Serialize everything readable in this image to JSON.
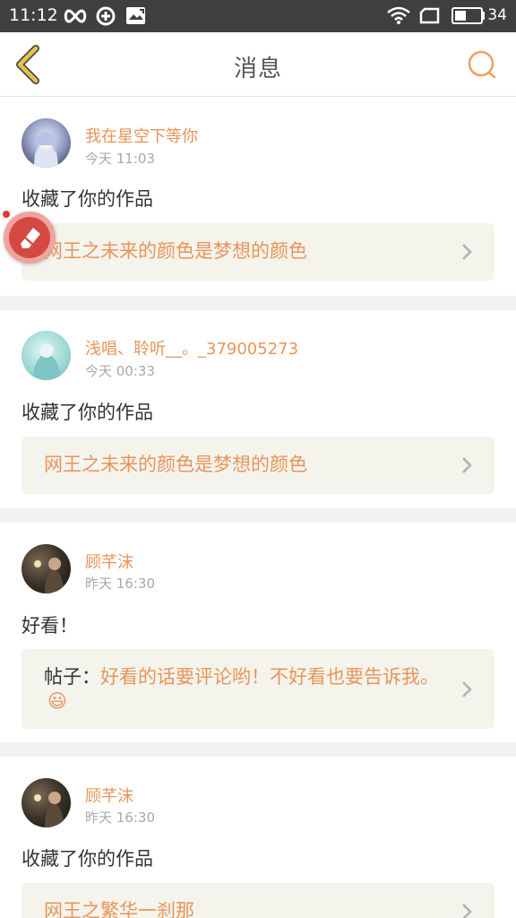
{
  "status_bar": {
    "time": "11:12",
    "battery_level": "34",
    "icons": [
      "infinity-icon",
      "sync-icon",
      "image-icon",
      "wifi-icon",
      "sim-icon",
      "battery-icon"
    ]
  },
  "header": {
    "title": "消息",
    "back_icon": "chevron-left-icon",
    "search_icon": "search-icon",
    "accent_color": "#e8c24a"
  },
  "messages": [
    {
      "username": "我在星空下等你",
      "time": "今天 11:03",
      "action": "收藏了你的作品",
      "ref_prefix": "",
      "ref_text": "网王之未来的颜色是梦想的颜色"
    },
    {
      "username": "浅唱、聆听__。_379005273",
      "time": "今天 00:33",
      "action": "收藏了你的作品",
      "ref_prefix": "",
      "ref_text": "网王之未来的颜色是梦想的颜色"
    },
    {
      "username": "顾芊沫",
      "time": "昨天 16:30",
      "action": "好看！",
      "ref_prefix": "帖子：",
      "ref_text": "好看的话要评论哟！不好看也要告诉我。",
      "ref_emoji": "😃"
    },
    {
      "username": "顾芊沫",
      "time": "昨天 16:30",
      "action": "收藏了你的作品",
      "ref_prefix": "",
      "ref_text": "网王之繁华一刹那"
    }
  ],
  "colors": {
    "username": "#e8945a",
    "ref_bg": "#f4f4ec",
    "status_bar": "#3f3f3f",
    "separator": "#f2f2f2",
    "badge": "#d44a42"
  }
}
